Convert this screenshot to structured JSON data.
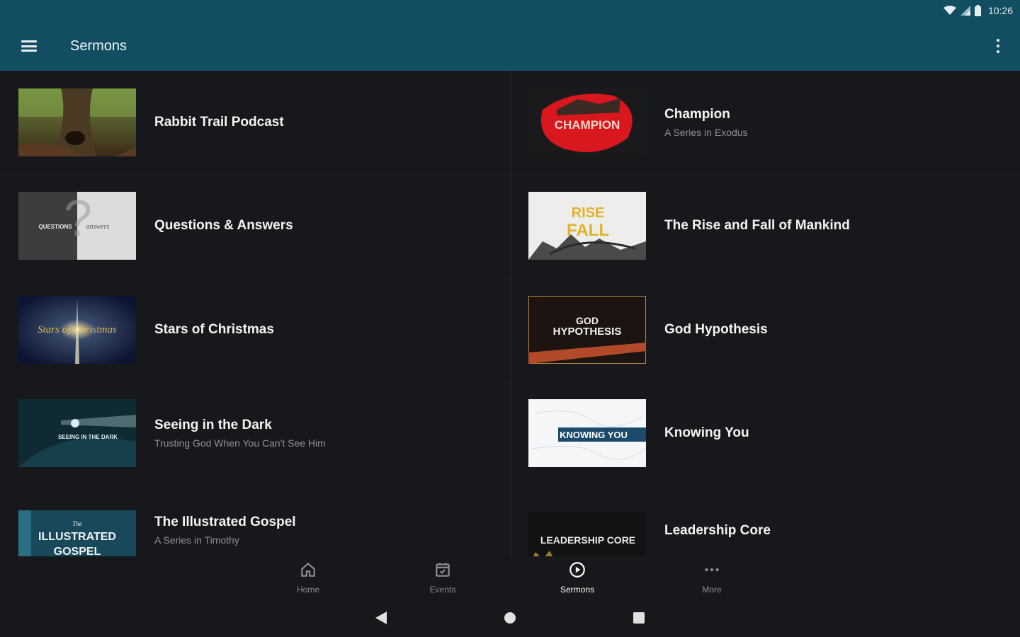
{
  "status_bar": {
    "time": "10:26"
  },
  "app_bar": {
    "title": "Sermons"
  },
  "sermons_left": [
    {
      "title": "Rabbit Trail Podcast",
      "subtitle": ""
    },
    {
      "title": "Questions & Answers",
      "subtitle": ""
    },
    {
      "title": "Stars of Christmas",
      "subtitle": ""
    },
    {
      "title": "Seeing in the Dark",
      "subtitle": "Trusting God When You Can't See Him"
    },
    {
      "title": "The Illustrated Gospel",
      "subtitle": "A Series in Timothy"
    }
  ],
  "sermons_right": [
    {
      "title": "Champion",
      "subtitle": "A Series in Exodus"
    },
    {
      "title": "The Rise and Fall of Mankind",
      "subtitle": ""
    },
    {
      "title": "God Hypothesis",
      "subtitle": ""
    },
    {
      "title": "Knowing You",
      "subtitle": ""
    },
    {
      "title": "Leadership Core",
      "subtitle": ""
    }
  ],
  "thumb_text": {
    "champion": "CHAMPION",
    "rise": "RISE",
    "fall": "FALL",
    "god": "GOD",
    "hypothesis": "HYPOTHESIS",
    "seeing": "SEEING IN THE DARK",
    "knowing": "KNOWING YOU",
    "illustrated_the": "The",
    "illustrated_1": "ILLUSTRATED",
    "illustrated_2": "GOSPEL",
    "leadership": "LEADERSHIP CORE",
    "questions": "QUESTIONS",
    "answers": "answers",
    "stars": "Stars of Christmas"
  },
  "bottom_nav": [
    {
      "label": "Home",
      "icon": "home-icon",
      "active": false
    },
    {
      "label": "Events",
      "icon": "calendar-icon",
      "active": false
    },
    {
      "label": "Sermons",
      "icon": "play-circle-icon",
      "active": true
    },
    {
      "label": "More",
      "icon": "more-horizontal-icon",
      "active": false
    }
  ],
  "colors": {
    "app_bar": "#124d62",
    "background": "#17181b",
    "accent_red": "#d8171f",
    "accent_gold": "#e0b32a"
  }
}
